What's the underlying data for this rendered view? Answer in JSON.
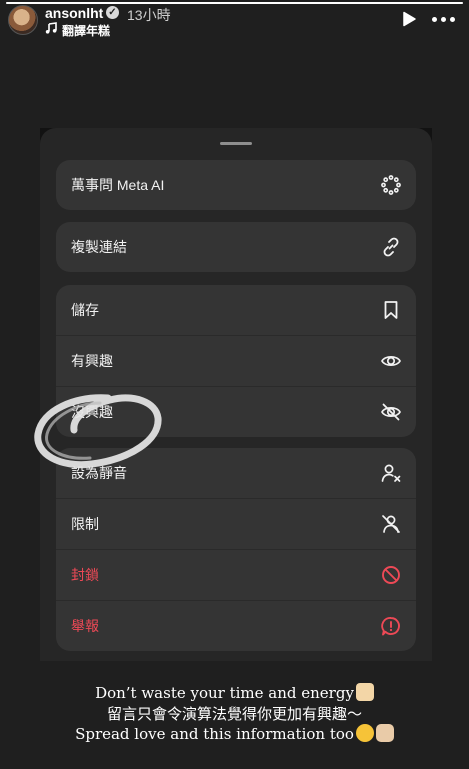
{
  "story": {
    "progress": 1.0
  },
  "header": {
    "username": "ansonlht",
    "time": "13小時",
    "music_label": "翻譯年糕"
  },
  "menu": {
    "group1": [
      {
        "label": "萬事問 Meta AI",
        "icon": "meta-ai-icon"
      }
    ],
    "group2": [
      {
        "label": "複製連結",
        "icon": "link-icon"
      }
    ],
    "group3": [
      {
        "label": "儲存",
        "icon": "bookmark-icon"
      },
      {
        "label": "有興趣",
        "icon": "eye-icon"
      },
      {
        "label": "沒興趣",
        "icon": "eye-off-icon"
      }
    ],
    "group4": [
      {
        "label": "設為靜音",
        "icon": "mute-user-icon"
      },
      {
        "label": "限制",
        "icon": "restrict-icon"
      },
      {
        "label": "封鎖",
        "icon": "block-icon",
        "danger": true
      },
      {
        "label": "舉報",
        "icon": "report-icon",
        "danger": true
      }
    ]
  },
  "caption": {
    "line1": "Don’t waste your time and energy",
    "line2": "留言只會令演算法覺得你更加有興趣～",
    "line3": "Spread love and this information too"
  },
  "colors": {
    "danger": "#ed4956",
    "sheet": "#262626",
    "group": "#343434"
  }
}
